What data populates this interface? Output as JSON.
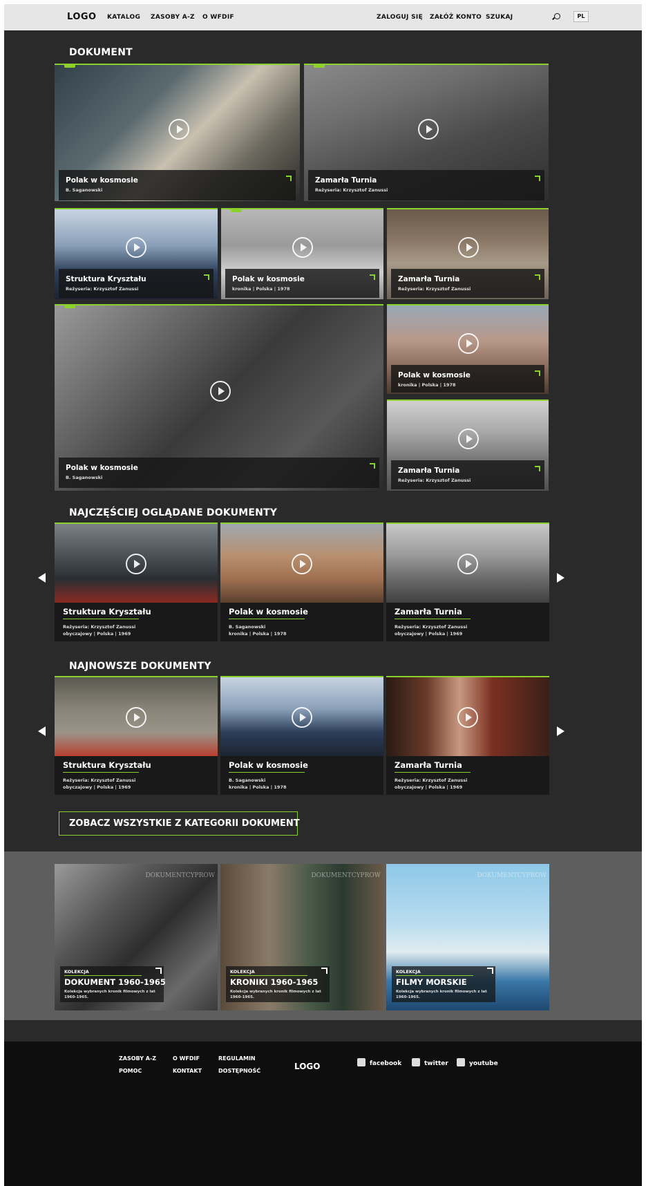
{
  "header": {
    "logo": "LOGO",
    "nav": [
      "KATALOG",
      "ZASOBY A-Z",
      "O WFDIF"
    ],
    "login": "ZALOGUJ SIĘ",
    "register": "ZAŁÓŻ KONTO",
    "search": "SZUKAJ",
    "lang": "PL"
  },
  "section_dokument": {
    "title": "DOKUMENT",
    "tiles": [
      {
        "title": "Polak w kosmosie",
        "sub": "B. Saganowski"
      },
      {
        "title": "Zamarła Turnia",
        "sub": "Reżyseria: Krzysztof Zanussi"
      },
      {
        "title": "Struktura Kryształu",
        "sub": "Reżyseria: Krzysztof Zanussi"
      },
      {
        "title": "Polak w kosmosie",
        "sub": "kronika  |  Polska  |  1978"
      },
      {
        "title": "Zamarła Turnia",
        "sub": "Reżyseria: Krzysztof Zanussi"
      },
      {
        "title": "Polak w kosmosie",
        "sub": "B. Saganowski"
      },
      {
        "title": "Polak w kosmosie",
        "sub": "kronika  |  Polska  |  1978"
      },
      {
        "title": "Zamarła Turnia",
        "sub": "Reżyseria: Krzysztof Zanussi"
      }
    ]
  },
  "most_watched": {
    "title": "NAJCZĘŚCIEJ OGLĄDANE DOKUMENTY",
    "cards": [
      {
        "title": "Struktura Kryształu",
        "meta1": "Reżyseria: Krzysztof Zanussi",
        "meta2": "obyczajowy  |  Polska  |  1969"
      },
      {
        "title": "Polak w kosmosie",
        "meta1": "B. Saganowski",
        "meta2": "kronika  |  Polska  |  1978"
      },
      {
        "title": "Zamarła Turnia",
        "meta1": "Reżyseria: Krzysztof Zanussi",
        "meta2": "obyczajowy  |  Polska  |  1969"
      }
    ]
  },
  "newest": {
    "title": "NAJNOWSZE DOKUMENTY",
    "cards": [
      {
        "title": "Struktura Kryształu",
        "meta1": "Reżyseria: Krzysztof Zanussi",
        "meta2": "obyczajowy  |  Polska  |  1969"
      },
      {
        "title": "Polak w kosmosie",
        "meta1": "B. Saganowski",
        "meta2": "kronika  |  Polska  |  1978"
      },
      {
        "title": "Zamarła Turnia",
        "meta1": "Reżyseria: Krzysztof Zanussi",
        "meta2": "obyczajowy  |  Polska  |  1969"
      }
    ]
  },
  "cta": "ZOBACZ WSZYSTKIE Z KATEGORII DOKUMENT",
  "collections": [
    {
      "label": "KOLEKCJA",
      "title": "DOKUMENT 1960-1965",
      "desc": "Kolekcja wybranych kronik filmowych z lat 1960-1965.",
      "watermark": "DOKUMENTCYPROW"
    },
    {
      "label": "KOLEKCJA",
      "title": "KRONIKI 1960-1965",
      "desc": "Kolekcja wybranych kronik filmowych z lat 1960-1965.",
      "watermark": "DOKUMENTCYPROW"
    },
    {
      "label": "KOLEKCJA",
      "title": "FILMY MORSKIE",
      "desc": "Kolekcja wybranych kronik filmowych z lat 1960-1965.",
      "watermark": "DOKUMENTCYPROW"
    }
  ],
  "footer": {
    "col1": [
      "ZASOBY A-Z",
      "POMOC"
    ],
    "col2": [
      "O WFDIF",
      "KONTAKT"
    ],
    "col3": [
      "REGULAMIN",
      "DOSTĘPNOŚĆ"
    ],
    "logo": "LOGO",
    "social": [
      "facebook",
      "twitter",
      "youtube"
    ]
  },
  "colors": {
    "accent": "#8bd12b",
    "background": "#2a2a2a",
    "header": "#e6e6e6"
  }
}
